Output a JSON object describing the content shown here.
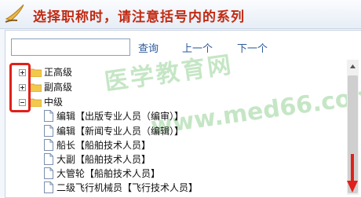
{
  "header": {
    "title": "选择职称时，请注意括号内的系列",
    "logo_icon": "quill-pen-icon"
  },
  "search": {
    "value": "",
    "placeholder": ""
  },
  "toolbar": {
    "query_label": "查询",
    "prev_label": "上一个",
    "next_label": "下一个"
  },
  "watermark": {
    "text_cn": "医学教育网",
    "text_url": "www.med66.com"
  },
  "tree": {
    "groups": [
      {
        "label": "正高级",
        "expanded": false
      },
      {
        "label": "副高级",
        "expanded": false
      },
      {
        "label": "中级",
        "expanded": true
      }
    ],
    "items": [
      {
        "label": "编辑【出版专业人员（编审）】"
      },
      {
        "label": "编辑【新闻专业人员（编辑）】"
      },
      {
        "label": "船长【船舶技术人员】"
      },
      {
        "label": "大副【船舶技术人员】"
      },
      {
        "label": "大管轮【船舶技术人员】"
      },
      {
        "label": "二级飞行机械员【飞行技术人员】"
      }
    ]
  },
  "colors": {
    "title": "#c12a12",
    "link": "#2c5a9c",
    "highlight": "#e0201a",
    "watermark": "#96d296"
  }
}
